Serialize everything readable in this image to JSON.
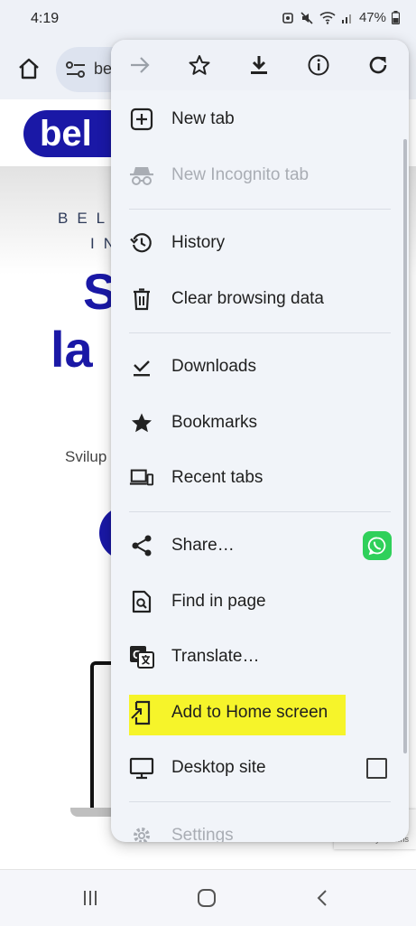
{
  "status_bar": {
    "time": "4:19",
    "battery": "47%"
  },
  "toolbar": {
    "url_partial": "be"
  },
  "page": {
    "logo_text": "bel",
    "spaced_line1": "BEL",
    "spaced_line2": "IN",
    "headline1": "S",
    "headline2": "la",
    "body_snippet": "Svilup",
    "recaptcha_text": "Privacy - Terms"
  },
  "menu": {
    "top_icons": [
      "forward-icon",
      "star-icon",
      "download-icon",
      "info-icon",
      "refresh-icon"
    ],
    "items": [
      {
        "label": "New tab",
        "icon": "new-tab-icon"
      },
      {
        "label": "New Incognito tab",
        "icon": "incognito-icon",
        "disabled": true
      },
      {
        "label": "History",
        "icon": "history-icon"
      },
      {
        "label": "Clear browsing data",
        "icon": "trash-icon"
      },
      {
        "label": "Downloads",
        "icon": "downloads-icon"
      },
      {
        "label": "Bookmarks",
        "icon": "bookmarks-star-icon"
      },
      {
        "label": "Recent tabs",
        "icon": "recent-tabs-icon"
      },
      {
        "label": "Share…",
        "icon": "share-icon"
      },
      {
        "label": "Find in page",
        "icon": "find-in-page-icon"
      },
      {
        "label": "Translate…",
        "icon": "translate-icon"
      },
      {
        "label": "Add to Home screen",
        "icon": "add-to-home-icon",
        "highlighted": true
      },
      {
        "label": "Desktop site",
        "icon": "desktop-icon",
        "checked": false
      },
      {
        "label": "Settings",
        "icon": "settings-gear-icon"
      }
    ]
  },
  "colors": {
    "highlight": "#f6f42a",
    "whatsapp": "#2fd05a",
    "brand_blue": "#1a18a6",
    "menu_bg": "#f1f4f9"
  }
}
